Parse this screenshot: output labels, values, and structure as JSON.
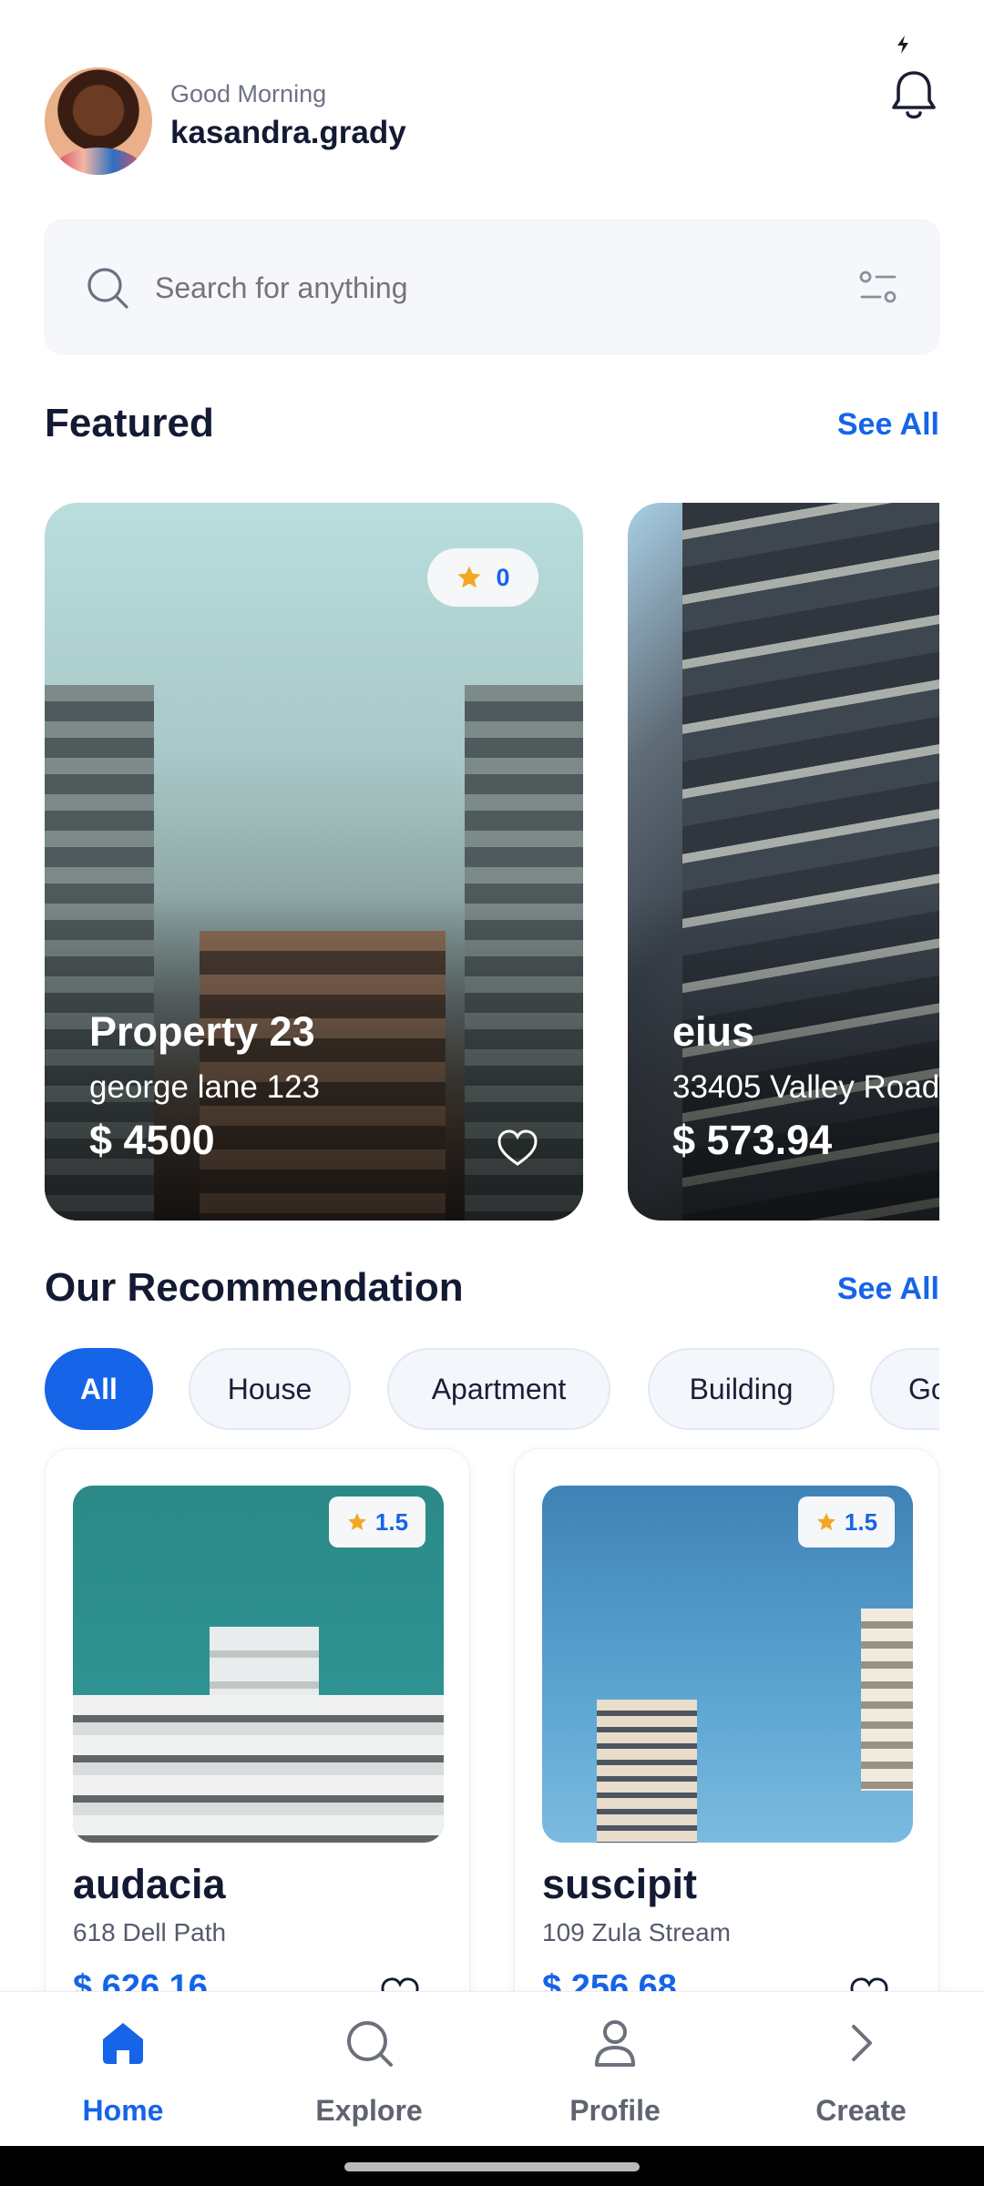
{
  "header": {
    "greeting": "Good Morning",
    "username": "kasandra.grady"
  },
  "search": {
    "placeholder": "Search for anything"
  },
  "featured": {
    "title": "Featured",
    "see_all": "See All",
    "cards": [
      {
        "rating": "0",
        "name": "Property 23",
        "address": "george lane 123",
        "price": "$ 4500"
      },
      {
        "name": "eius",
        "address": "33405 Valley Road",
        "price": "$ 573.94"
      }
    ]
  },
  "recommendation": {
    "title": "Our Recommendation",
    "see_all": "See All",
    "chips": [
      "All",
      "House",
      "Apartment",
      "Building",
      "Go"
    ],
    "active_chip": "All",
    "cards": [
      {
        "rating": "1.5",
        "name": "audacia",
        "address": "618 Dell Path",
        "price": "$ 626.16"
      },
      {
        "rating": "1.5",
        "name": "suscipit",
        "address": "109 Zula Stream",
        "price": "$ 256.68"
      }
    ]
  },
  "nav": {
    "items": [
      {
        "label": "Home",
        "icon": "home-icon",
        "active": true
      },
      {
        "label": "Explore",
        "icon": "search-icon",
        "active": false
      },
      {
        "label": "Profile",
        "icon": "user-icon",
        "active": false
      },
      {
        "label": "Create",
        "icon": "chevron-right-icon",
        "active": false
      }
    ]
  },
  "colors": {
    "accent": "#1664e8",
    "star": "#f5a623",
    "text_dark": "#131a33"
  }
}
